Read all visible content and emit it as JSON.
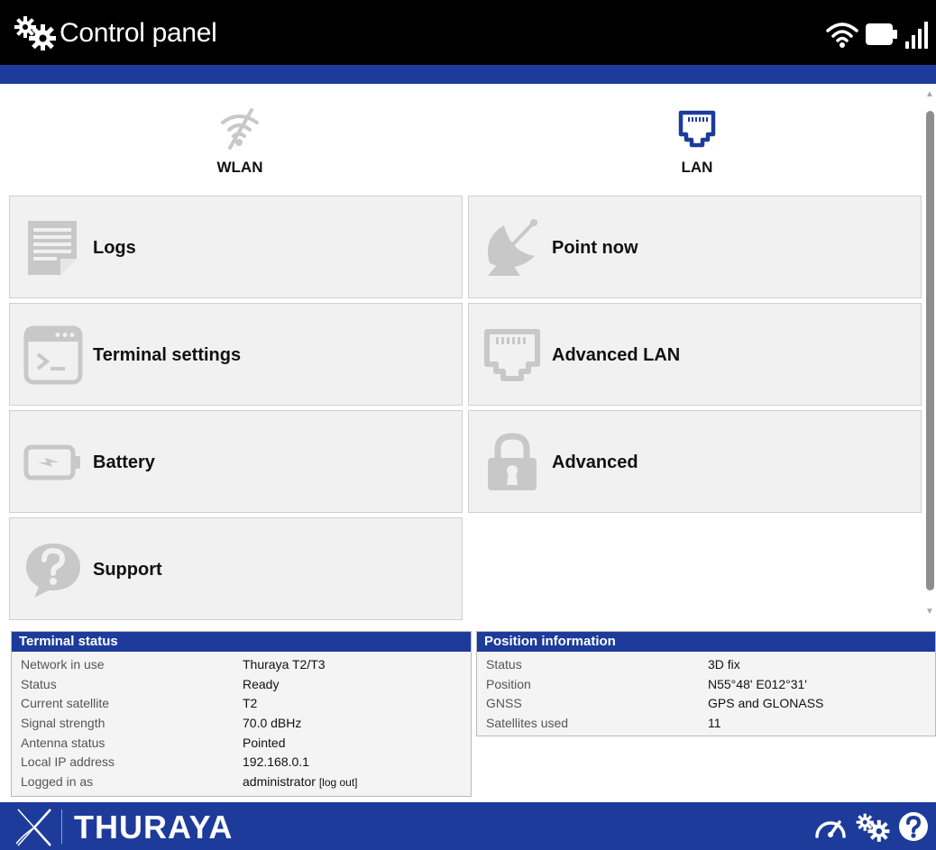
{
  "header": {
    "title": "Control panel",
    "title_icon": "gears-icon",
    "status_icons": [
      "wifi-icon",
      "battery-icon",
      "signal-bars-icon"
    ]
  },
  "quick": {
    "wlan": {
      "label": "WLAN",
      "icon": "wifi-off-icon"
    },
    "lan": {
      "label": "LAN",
      "icon": "ethernet-port-icon"
    }
  },
  "tiles": {
    "logs": {
      "label": "Logs",
      "icon": "document-icon"
    },
    "point_now": {
      "label": "Point now",
      "icon": "satellite-dish-icon"
    },
    "terminal_settings": {
      "label": "Terminal settings",
      "icon": "terminal-icon"
    },
    "advanced_lan": {
      "label": "Advanced LAN",
      "icon": "ethernet-port-icon"
    },
    "battery": {
      "label": "Battery",
      "icon": "battery-charging-icon"
    },
    "advanced": {
      "label": "Advanced",
      "icon": "padlock-icon"
    },
    "support": {
      "label": "Support",
      "icon": "question-bubble-icon"
    }
  },
  "terminal_status": {
    "title": "Terminal status",
    "rows": [
      {
        "key": "Network in use",
        "value": "Thuraya T2/T3"
      },
      {
        "key": "Status",
        "value": "Ready"
      },
      {
        "key": "Current satellite",
        "value": "T2"
      },
      {
        "key": "Signal strength",
        "value": "70.0 dBHz"
      },
      {
        "key": "Antenna status",
        "value": "Pointed"
      },
      {
        "key": "Local IP address",
        "value": "192.168.0.1"
      },
      {
        "key": "Logged in as",
        "value": "administrator"
      }
    ],
    "logout_label": "[log out]"
  },
  "position_information": {
    "title": "Position information",
    "rows": [
      {
        "key": "Status",
        "value": "3D fix"
      },
      {
        "key": "Position",
        "value": "N55°48' E012°31'"
      },
      {
        "key": "GNSS",
        "value": "GPS and GLONASS"
      },
      {
        "key": "Satellites used",
        "value": "11"
      }
    ]
  },
  "footer": {
    "brand": "THURAYA",
    "icons": [
      "dashboard-gauge-icon",
      "gears-icon",
      "help-circle-icon"
    ]
  },
  "colors": {
    "header_bg": "#000000",
    "accent_blue": "#1d3b9a",
    "tile_bg": "#f1f1f1",
    "icon_gray": "#c8c8c8",
    "lan_blue": "#1d3b9a"
  }
}
